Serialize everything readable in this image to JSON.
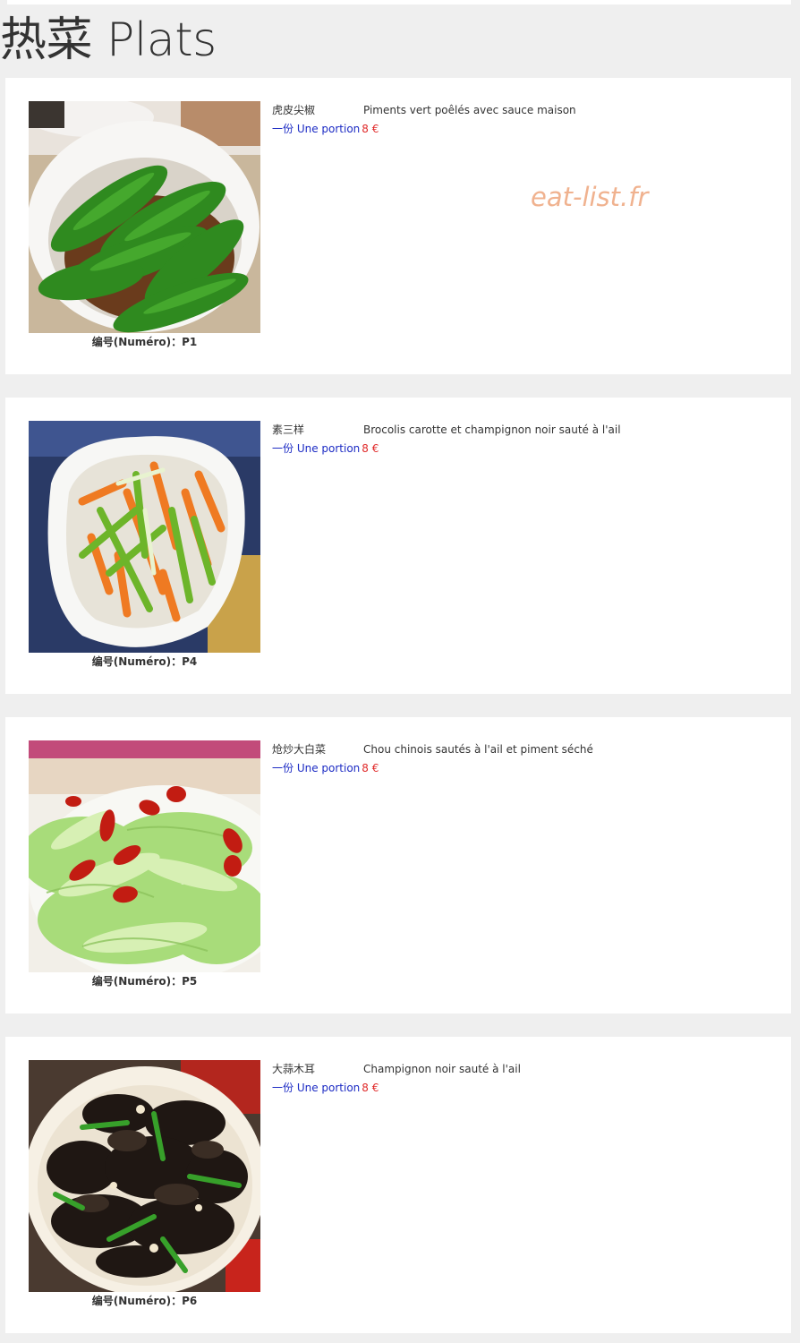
{
  "section_title": "热菜 Plats",
  "watermark": "eat-list.fr",
  "number_prefix": "编号(Numéro)：",
  "colors": {
    "page_background": "#efefef",
    "card_background": "#ffffff",
    "portion_label": "#1c2bc4",
    "price": "#e02a2a",
    "watermark": "#f0b28f"
  },
  "dishes": [
    {
      "number": "P1",
      "number_label": "编号(Numéro)：P1",
      "name": "虎皮尖椒",
      "description": "Piments vert poêlés avec sauce maison",
      "portion_label": "一份 Une portion",
      "price": "8 €",
      "photo": "sauteed-green-peppers-photo"
    },
    {
      "number": "P4",
      "number_label": "编号(Numéro)：P4",
      "name": "素三样",
      "description": "Brocolis carotte et champignon noir sauté à l'ail",
      "portion_label": "一份 Une portion",
      "price": "8 €",
      "photo": "carrot-celery-stirfry-photo"
    },
    {
      "number": "P5",
      "number_label": "编号(Numéro)：P5",
      "name": "炝炒大白菜",
      "description": "Chou chinois sautés à l'ail et piment séché",
      "portion_label": "一份 Une portion",
      "price": "8 €",
      "photo": "cabbage-with-chili-photo"
    },
    {
      "number": "P6",
      "number_label": "编号(Numéro)：P6",
      "name": "大蒜木耳",
      "description": "Champignon noir sauté à l'ail",
      "portion_label": "一份 Une portion",
      "price": "8 €",
      "photo": "wood-ear-mushroom-photo"
    }
  ]
}
